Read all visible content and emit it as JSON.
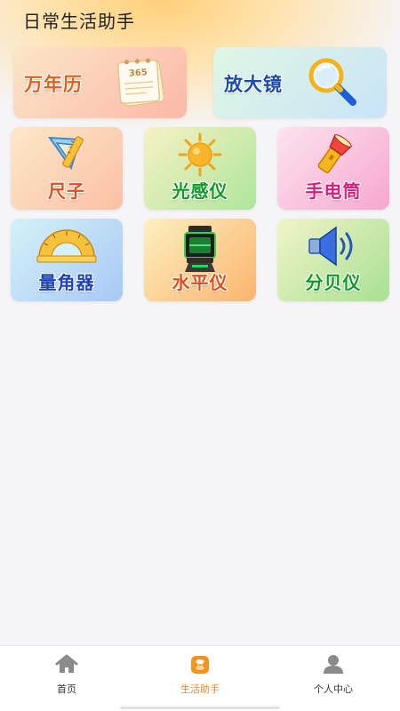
{
  "header": {
    "title": "日常生活助手"
  },
  "tools": {
    "calendar": {
      "label": "万年历",
      "icon": "calendar-365-icon",
      "badge": "365"
    },
    "magnifier": {
      "label": "放大镜",
      "icon": "magnifier-icon"
    },
    "ruler": {
      "label": "尺子",
      "icon": "ruler-icon"
    },
    "light_meter": {
      "label": "光感仪",
      "icon": "sun-icon"
    },
    "flashlight": {
      "label": "手电筒",
      "icon": "flashlight-icon"
    },
    "protractor": {
      "label": "量角器",
      "icon": "protractor-icon"
    },
    "level": {
      "label": "水平仪",
      "icon": "laser-level-icon"
    },
    "decibel": {
      "label": "分贝仪",
      "icon": "speaker-icon"
    }
  },
  "bottom_nav": {
    "items": [
      {
        "label": "首页",
        "icon": "home-icon",
        "active": false
      },
      {
        "label": "生活助手",
        "icon": "life-assistant-icon",
        "active": true
      },
      {
        "label": "个人中心",
        "icon": "user-icon",
        "active": false
      }
    ],
    "active_color": "#f28a1b"
  }
}
